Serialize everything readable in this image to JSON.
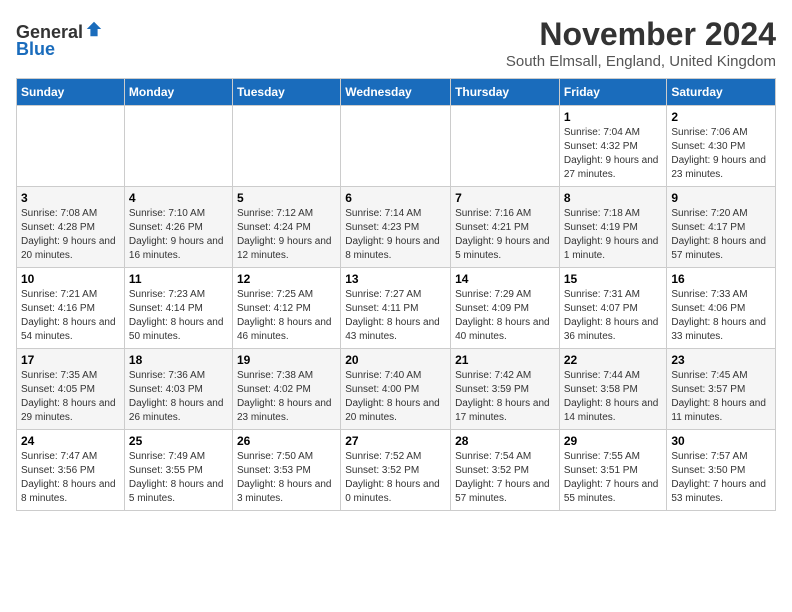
{
  "header": {
    "logo_general": "General",
    "logo_blue": "Blue",
    "month_title": "November 2024",
    "subtitle": "South Elmsall, England, United Kingdom"
  },
  "days_of_week": [
    "Sunday",
    "Monday",
    "Tuesday",
    "Wednesday",
    "Thursday",
    "Friday",
    "Saturday"
  ],
  "weeks": [
    [
      {
        "day": "",
        "info": ""
      },
      {
        "day": "",
        "info": ""
      },
      {
        "day": "",
        "info": ""
      },
      {
        "day": "",
        "info": ""
      },
      {
        "day": "",
        "info": ""
      },
      {
        "day": "1",
        "info": "Sunrise: 7:04 AM\nSunset: 4:32 PM\nDaylight: 9 hours and 27 minutes."
      },
      {
        "day": "2",
        "info": "Sunrise: 7:06 AM\nSunset: 4:30 PM\nDaylight: 9 hours and 23 minutes."
      }
    ],
    [
      {
        "day": "3",
        "info": "Sunrise: 7:08 AM\nSunset: 4:28 PM\nDaylight: 9 hours and 20 minutes."
      },
      {
        "day": "4",
        "info": "Sunrise: 7:10 AM\nSunset: 4:26 PM\nDaylight: 9 hours and 16 minutes."
      },
      {
        "day": "5",
        "info": "Sunrise: 7:12 AM\nSunset: 4:24 PM\nDaylight: 9 hours and 12 minutes."
      },
      {
        "day": "6",
        "info": "Sunrise: 7:14 AM\nSunset: 4:23 PM\nDaylight: 9 hours and 8 minutes."
      },
      {
        "day": "7",
        "info": "Sunrise: 7:16 AM\nSunset: 4:21 PM\nDaylight: 9 hours and 5 minutes."
      },
      {
        "day": "8",
        "info": "Sunrise: 7:18 AM\nSunset: 4:19 PM\nDaylight: 9 hours and 1 minute."
      },
      {
        "day": "9",
        "info": "Sunrise: 7:20 AM\nSunset: 4:17 PM\nDaylight: 8 hours and 57 minutes."
      }
    ],
    [
      {
        "day": "10",
        "info": "Sunrise: 7:21 AM\nSunset: 4:16 PM\nDaylight: 8 hours and 54 minutes."
      },
      {
        "day": "11",
        "info": "Sunrise: 7:23 AM\nSunset: 4:14 PM\nDaylight: 8 hours and 50 minutes."
      },
      {
        "day": "12",
        "info": "Sunrise: 7:25 AM\nSunset: 4:12 PM\nDaylight: 8 hours and 46 minutes."
      },
      {
        "day": "13",
        "info": "Sunrise: 7:27 AM\nSunset: 4:11 PM\nDaylight: 8 hours and 43 minutes."
      },
      {
        "day": "14",
        "info": "Sunrise: 7:29 AM\nSunset: 4:09 PM\nDaylight: 8 hours and 40 minutes."
      },
      {
        "day": "15",
        "info": "Sunrise: 7:31 AM\nSunset: 4:07 PM\nDaylight: 8 hours and 36 minutes."
      },
      {
        "day": "16",
        "info": "Sunrise: 7:33 AM\nSunset: 4:06 PM\nDaylight: 8 hours and 33 minutes."
      }
    ],
    [
      {
        "day": "17",
        "info": "Sunrise: 7:35 AM\nSunset: 4:05 PM\nDaylight: 8 hours and 29 minutes."
      },
      {
        "day": "18",
        "info": "Sunrise: 7:36 AM\nSunset: 4:03 PM\nDaylight: 8 hours and 26 minutes."
      },
      {
        "day": "19",
        "info": "Sunrise: 7:38 AM\nSunset: 4:02 PM\nDaylight: 8 hours and 23 minutes."
      },
      {
        "day": "20",
        "info": "Sunrise: 7:40 AM\nSunset: 4:00 PM\nDaylight: 8 hours and 20 minutes."
      },
      {
        "day": "21",
        "info": "Sunrise: 7:42 AM\nSunset: 3:59 PM\nDaylight: 8 hours and 17 minutes."
      },
      {
        "day": "22",
        "info": "Sunrise: 7:44 AM\nSunset: 3:58 PM\nDaylight: 8 hours and 14 minutes."
      },
      {
        "day": "23",
        "info": "Sunrise: 7:45 AM\nSunset: 3:57 PM\nDaylight: 8 hours and 11 minutes."
      }
    ],
    [
      {
        "day": "24",
        "info": "Sunrise: 7:47 AM\nSunset: 3:56 PM\nDaylight: 8 hours and 8 minutes."
      },
      {
        "day": "25",
        "info": "Sunrise: 7:49 AM\nSunset: 3:55 PM\nDaylight: 8 hours and 5 minutes."
      },
      {
        "day": "26",
        "info": "Sunrise: 7:50 AM\nSunset: 3:53 PM\nDaylight: 8 hours and 3 minutes."
      },
      {
        "day": "27",
        "info": "Sunrise: 7:52 AM\nSunset: 3:52 PM\nDaylight: 8 hours and 0 minutes."
      },
      {
        "day": "28",
        "info": "Sunrise: 7:54 AM\nSunset: 3:52 PM\nDaylight: 7 hours and 57 minutes."
      },
      {
        "day": "29",
        "info": "Sunrise: 7:55 AM\nSunset: 3:51 PM\nDaylight: 7 hours and 55 minutes."
      },
      {
        "day": "30",
        "info": "Sunrise: 7:57 AM\nSunset: 3:50 PM\nDaylight: 7 hours and 53 minutes."
      }
    ]
  ]
}
